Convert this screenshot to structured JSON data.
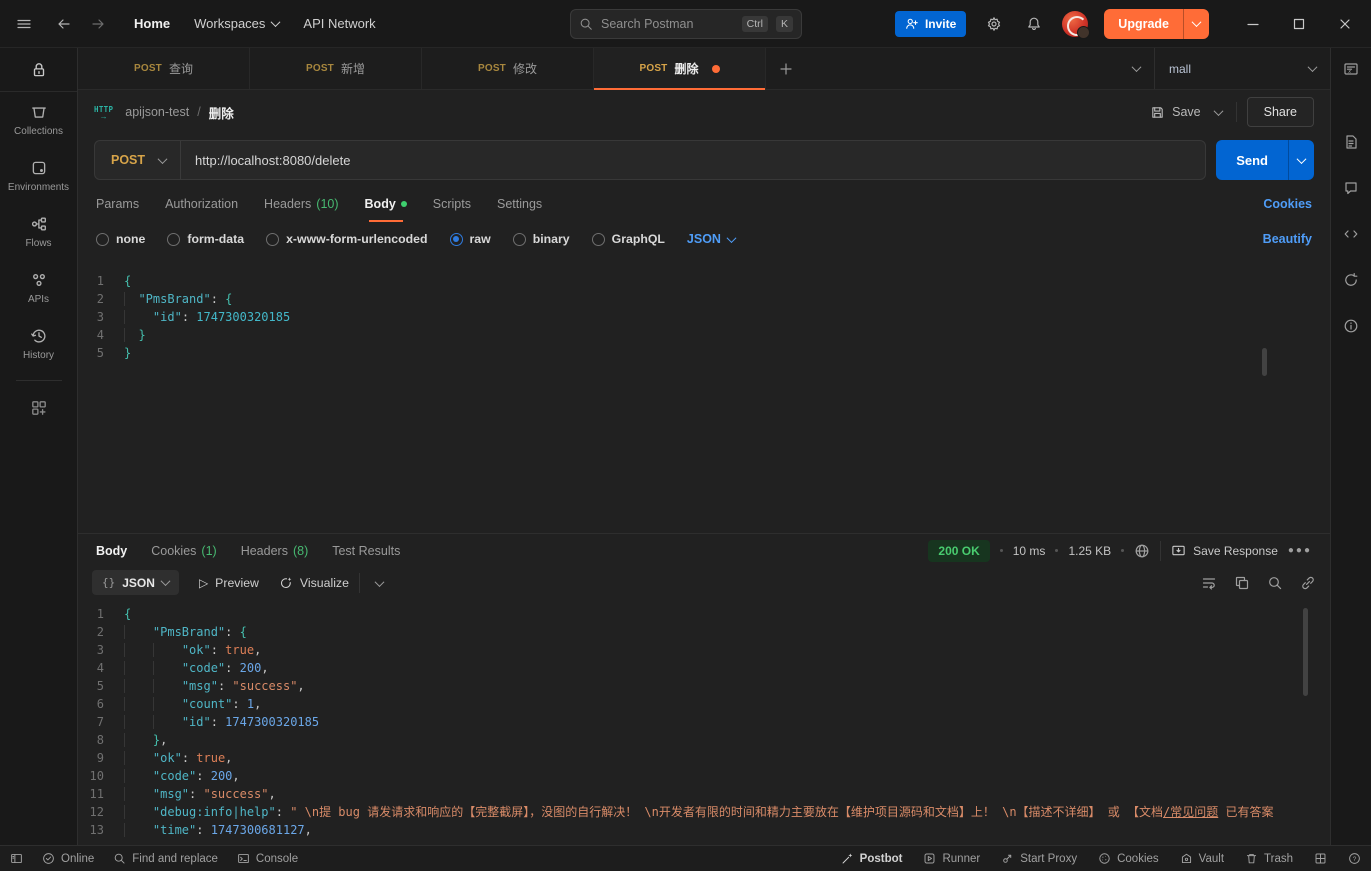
{
  "topbar": {
    "home": "Home",
    "workspaces": "Workspaces",
    "api_network": "API Network",
    "search_placeholder": "Search Postman",
    "shortcut_ctrl": "Ctrl",
    "shortcut_k": "K",
    "invite": "Invite",
    "upgrade": "Upgrade"
  },
  "sidebar": {
    "items": [
      {
        "label": "Collections"
      },
      {
        "label": "Environments"
      },
      {
        "label": "Flows"
      },
      {
        "label": "APIs"
      },
      {
        "label": "History"
      }
    ]
  },
  "tabbar": {
    "tabs": [
      {
        "method": "POST",
        "title": "查询"
      },
      {
        "method": "POST",
        "title": "新增"
      },
      {
        "method": "POST",
        "title": "修改"
      },
      {
        "method": "POST",
        "title": "删除"
      }
    ],
    "environment": "mall"
  },
  "breadcrumb": {
    "collection": "apijson-test",
    "separator": "/",
    "request": "删除"
  },
  "header_actions": {
    "save": "Save",
    "share": "Share"
  },
  "request": {
    "method": "POST",
    "url": "http://localhost:8080/delete",
    "send": "Send",
    "tabs": {
      "params": "Params",
      "authorization": "Authorization",
      "headers": "Headers",
      "headers_count": "(10)",
      "body": "Body",
      "scripts": "Scripts",
      "settings": "Settings"
    },
    "cookies_link": "Cookies",
    "modes": [
      "none",
      "form-data",
      "x-www-form-urlencoded",
      "raw",
      "binary",
      "GraphQL"
    ],
    "selected_mode": "raw",
    "language": "JSON",
    "beautify": "Beautify"
  },
  "request_code": {
    "lines": [
      {
        "n": "1",
        "tokens": [
          {
            "c": "brace",
            "t": "{"
          }
        ]
      },
      {
        "n": "2",
        "tokens": [
          {
            "c": "ws",
            "t": "  "
          },
          {
            "c": "key",
            "t": "\"PmsBrand\""
          },
          {
            "c": "p",
            "t": ": "
          },
          {
            "c": "brace",
            "t": "{"
          }
        ]
      },
      {
        "n": "3",
        "tokens": [
          {
            "c": "ws",
            "t": "    "
          },
          {
            "c": "key",
            "t": "\"id\""
          },
          {
            "c": "p",
            "t": ": "
          },
          {
            "c": "numt",
            "t": "1747300320185"
          }
        ]
      },
      {
        "n": "4",
        "tokens": [
          {
            "c": "ws",
            "t": "  "
          },
          {
            "c": "brace",
            "t": "}"
          }
        ]
      },
      {
        "n": "5",
        "tokens": [
          {
            "c": "brace",
            "t": "}"
          }
        ]
      }
    ]
  },
  "response": {
    "tabs": {
      "body": "Body",
      "cookies": "Cookies",
      "cookies_count": "(1)",
      "headers": "Headers",
      "headers_count": "(8)",
      "test_results": "Test Results"
    },
    "status": "200 OK",
    "time": "10 ms",
    "size": "1.25 KB",
    "save_response": "Save Response",
    "format": "JSON",
    "preview": "Preview",
    "visualize": "Visualize"
  },
  "response_code": {
    "lines": [
      {
        "n": "1",
        "tokens": [
          {
            "c": "brace",
            "t": "{"
          }
        ]
      },
      {
        "n": "2",
        "tokens": [
          {
            "c": "ws",
            "t": "    "
          },
          {
            "c": "key",
            "t": "\"PmsBrand\""
          },
          {
            "c": "p",
            "t": ": "
          },
          {
            "c": "brace",
            "t": "{"
          }
        ]
      },
      {
        "n": "3",
        "tokens": [
          {
            "c": "ws",
            "t": "    "
          },
          {
            "c": "ws",
            "t": "    "
          },
          {
            "c": "key",
            "t": "\"ok\""
          },
          {
            "c": "p",
            "t": ": "
          },
          {
            "c": "bool",
            "t": "true"
          },
          {
            "c": "p",
            "t": ","
          }
        ]
      },
      {
        "n": "4",
        "tokens": [
          {
            "c": "ws",
            "t": "    "
          },
          {
            "c": "ws",
            "t": "    "
          },
          {
            "c": "key",
            "t": "\"code\""
          },
          {
            "c": "p",
            "t": ": "
          },
          {
            "c": "num",
            "t": "200"
          },
          {
            "c": "p",
            "t": ","
          }
        ]
      },
      {
        "n": "5",
        "tokens": [
          {
            "c": "ws",
            "t": "    "
          },
          {
            "c": "ws",
            "t": "    "
          },
          {
            "c": "key",
            "t": "\"msg\""
          },
          {
            "c": "p",
            "t": ": "
          },
          {
            "c": "str",
            "t": "\"success\""
          },
          {
            "c": "p",
            "t": ","
          }
        ]
      },
      {
        "n": "6",
        "tokens": [
          {
            "c": "ws",
            "t": "    "
          },
          {
            "c": "ws",
            "t": "    "
          },
          {
            "c": "key",
            "t": "\"count\""
          },
          {
            "c": "p",
            "t": ": "
          },
          {
            "c": "num",
            "t": "1"
          },
          {
            "c": "p",
            "t": ","
          }
        ]
      },
      {
        "n": "7",
        "tokens": [
          {
            "c": "ws",
            "t": "    "
          },
          {
            "c": "ws",
            "t": "    "
          },
          {
            "c": "key",
            "t": "\"id\""
          },
          {
            "c": "p",
            "t": ": "
          },
          {
            "c": "num",
            "t": "1747300320185"
          }
        ]
      },
      {
        "n": "8",
        "tokens": [
          {
            "c": "ws",
            "t": "    "
          },
          {
            "c": "brace",
            "t": "}"
          },
          {
            "c": "p",
            "t": ","
          }
        ]
      },
      {
        "n": "9",
        "tokens": [
          {
            "c": "ws",
            "t": "    "
          },
          {
            "c": "key",
            "t": "\"ok\""
          },
          {
            "c": "p",
            "t": ": "
          },
          {
            "c": "bool",
            "t": "true"
          },
          {
            "c": "p",
            "t": ","
          }
        ]
      },
      {
        "n": "10",
        "tokens": [
          {
            "c": "ws",
            "t": "    "
          },
          {
            "c": "key",
            "t": "\"code\""
          },
          {
            "c": "p",
            "t": ": "
          },
          {
            "c": "num",
            "t": "200"
          },
          {
            "c": "p",
            "t": ","
          }
        ]
      },
      {
        "n": "11",
        "tokens": [
          {
            "c": "ws",
            "t": "    "
          },
          {
            "c": "key",
            "t": "\"msg\""
          },
          {
            "c": "p",
            "t": ": "
          },
          {
            "c": "str",
            "t": "\"success\""
          },
          {
            "c": "p",
            "t": ","
          }
        ]
      },
      {
        "n": "12",
        "tokens": [
          {
            "c": "ws",
            "t": "    "
          },
          {
            "c": "key",
            "t": "\"debug:info|help\""
          },
          {
            "c": "p",
            "t": ": "
          },
          {
            "c": "str",
            "t": "\" \\n提 bug 请发请求和响应的【完整截屏】，没图的自行解决！ \\n开发者有限的时间和精力主要放在【维护项目源码和文档】上！ \\n【描述不详细】 或 【文档"
          },
          {
            "c": "strlink",
            "t": "/常见问题"
          },
          {
            "c": "str",
            "t": " 已有答案"
          }
        ]
      },
      {
        "n": "13",
        "tokens": [
          {
            "c": "ws",
            "t": "    "
          },
          {
            "c": "key",
            "t": "\"time\""
          },
          {
            "c": "p",
            "t": ": "
          },
          {
            "c": "num",
            "t": "1747300681127"
          },
          {
            "c": "p",
            "t": ","
          }
        ]
      }
    ]
  },
  "statusbar": {
    "online": "Online",
    "find_and_replace": "Find and replace",
    "console": "Console",
    "postbot": "Postbot",
    "runner": "Runner",
    "start_proxy": "Start Proxy",
    "cookies": "Cookies",
    "vault": "Vault",
    "trash": "Trash"
  },
  "colors": {
    "accent_orange": "#ff6c37",
    "send_blue": "#0265d2",
    "link_blue": "#4f9df8",
    "count_green": "#47b971",
    "method_gold": "#d7a449",
    "status_green": "#49cc6f"
  }
}
